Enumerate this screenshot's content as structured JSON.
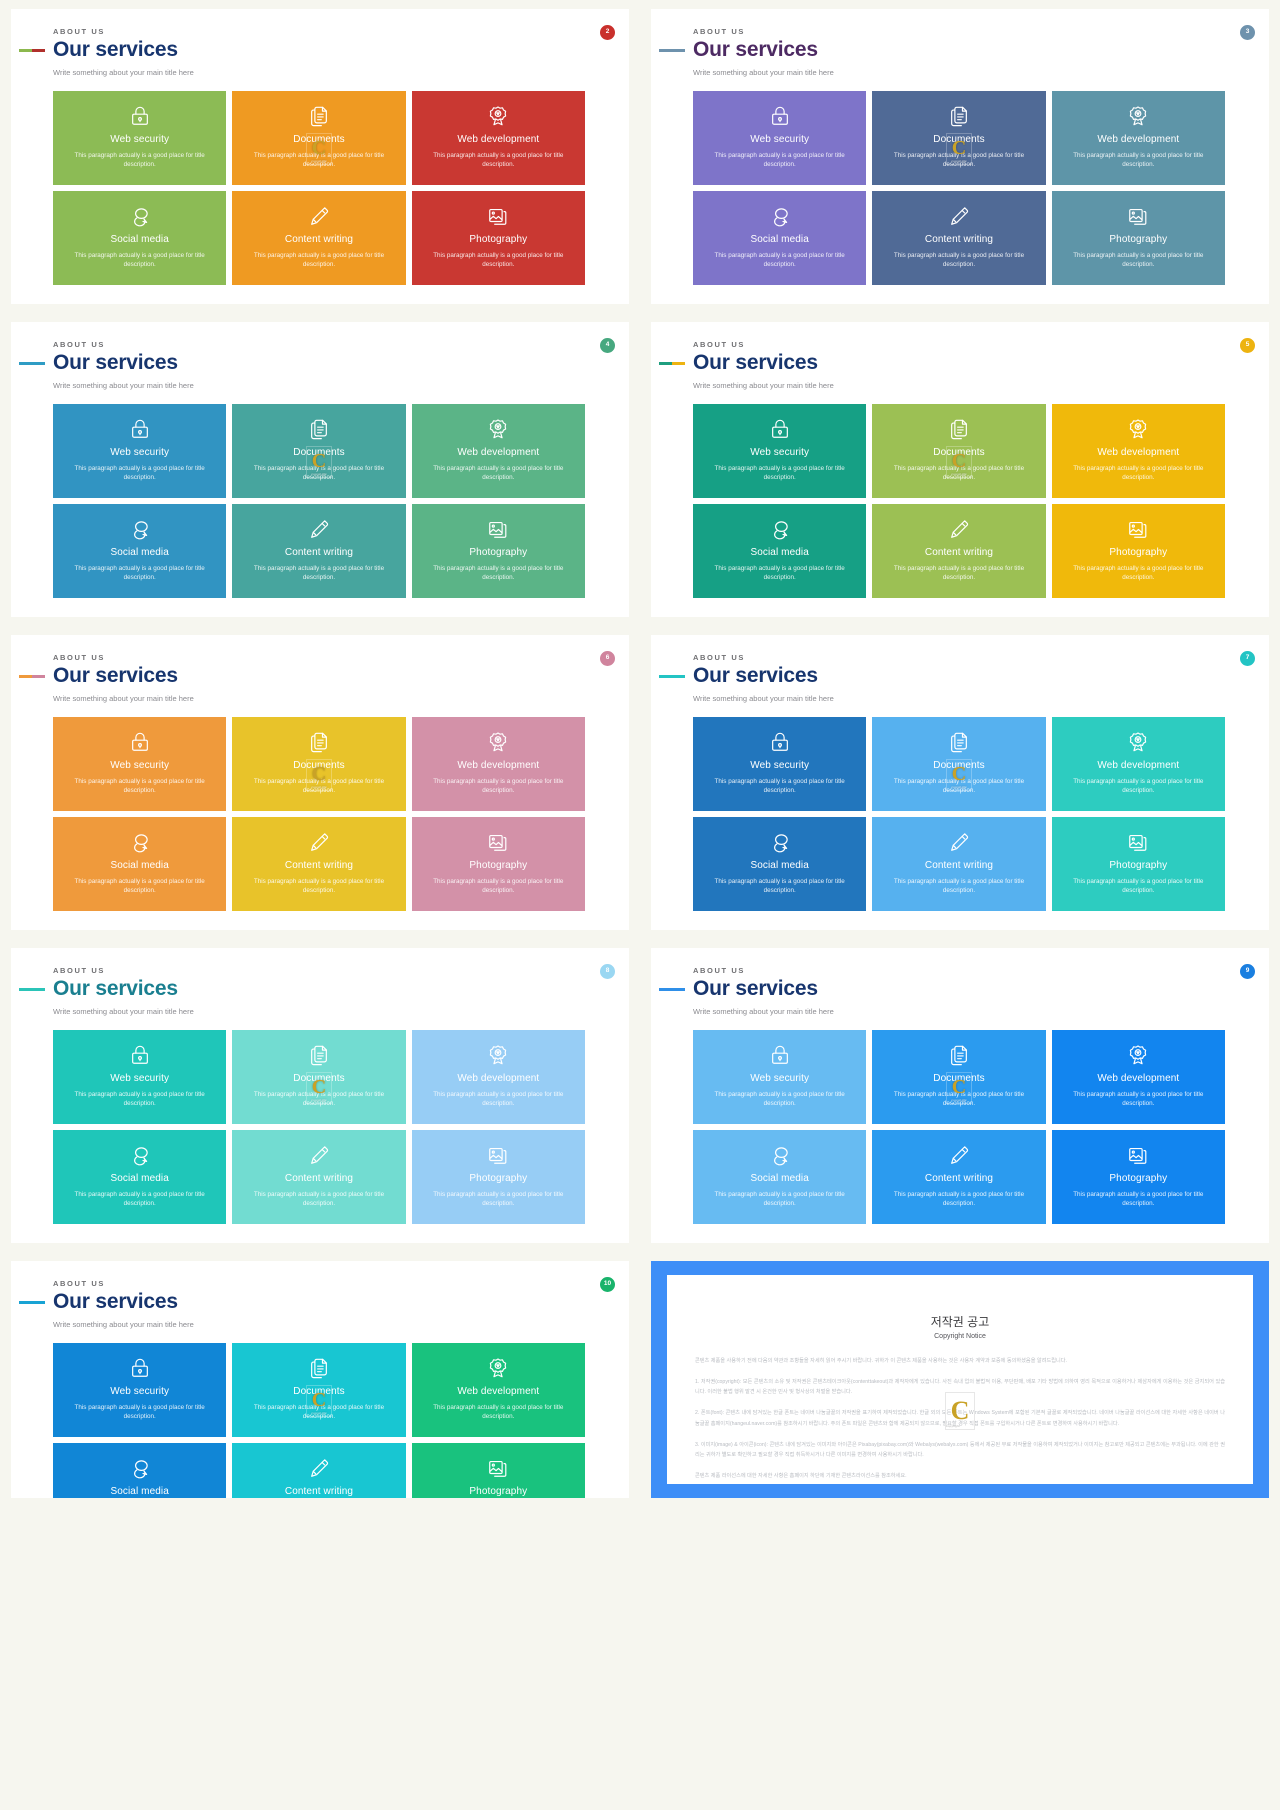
{
  "slide_common": {
    "eyebrow": "ABOUT US",
    "title": "Our services",
    "subtitle": "Write something about your main title here",
    "cards": [
      {
        "icon": "lock-icon",
        "title": "Web security",
        "desc": "This paragraph  actually is a good place for title description."
      },
      {
        "icon": "document-icon",
        "title": "Documents",
        "desc": "This paragraph  actually is a good place for title description."
      },
      {
        "icon": "badge-icon",
        "title": "Web development",
        "desc": "This paragraph  actually is a good place for title description."
      },
      {
        "icon": "chat-icon",
        "title": "Social media",
        "desc": "This paragraph  actually is a good place for title description."
      },
      {
        "icon": "pencil-icon",
        "title": "Content writing",
        "desc": "This paragraph  actually is a good place for title description."
      },
      {
        "icon": "photo-icon",
        "title": "Photography",
        "desc": "This paragraph  actually is a good place for title description."
      }
    ]
  },
  "slides": [
    {
      "id": "slide-green-orange-red",
      "badge": "2",
      "badge_color": "#c9302c",
      "title_color": "#17356e",
      "accent": [
        "#8cb84e",
        "#b0302c"
      ],
      "card_colors": [
        "#8cbb55",
        "#ef9a22",
        "#c93832",
        "#8cbb55",
        "#ef9a22",
        "#c93832"
      ]
    },
    {
      "id": "slide-purple-slate-teal",
      "badge": "3",
      "badge_color": "#6e92ad",
      "title_color": "#4d2a63",
      "accent": [
        "#6e92ad",
        "#6e92ad"
      ],
      "card_colors": [
        "#7e74c9",
        "#506a96",
        "#5e95a8",
        "#7e74c9",
        "#506a96",
        "#5e95a8"
      ]
    },
    {
      "id": "slide-blue-teal-green",
      "badge": "4",
      "badge_color": "#47a87f",
      "title_color": "#17356e",
      "accent": [
        "#2f9cc4",
        "#2f9cc4"
      ],
      "card_colors": [
        "#3194c2",
        "#47a59e",
        "#5bb487",
        "#3194c2",
        "#47a59e",
        "#5bb487"
      ]
    },
    {
      "id": "slide-emerald-olive-gold",
      "badge": "5",
      "badge_color": "#edb310",
      "title_color": "#17356e",
      "accent": [
        "#1f9e7f",
        "#edb310"
      ],
      "card_colors": [
        "#16a085",
        "#9cc054",
        "#f0b90b",
        "#16a085",
        "#9cc054",
        "#f0b90b"
      ]
    },
    {
      "id": "slide-orange-yellow-pink",
      "badge": "6",
      "badge_color": "#d0849d",
      "title_color": "#17356e",
      "accent": [
        "#ef9a3c",
        "#d0849d"
      ],
      "card_colors": [
        "#ef9a3c",
        "#e8c32a",
        "#d391a8",
        "#ef9a3c",
        "#e8c32a",
        "#d391a8"
      ]
    },
    {
      "id": "slide-navy-sky-turquoise",
      "badge": "7",
      "badge_color": "#23c4c4",
      "title_color": "#17356e",
      "accent": [
        "#23c4c4",
        "#23c4c4"
      ],
      "card_colors": [
        "#2276bd",
        "#56b1ef",
        "#2dccc0",
        "#2276bd",
        "#56b1ef",
        "#2dccc0"
      ]
    },
    {
      "id": "slide-turquoise-mint-lightblue",
      "badge": "8",
      "badge_color": "#9ad7f2",
      "title_color": "#1a7f90",
      "accent": [
        "#2bc4b8",
        "#2bc4b8"
      ],
      "card_colors": [
        "#1fc6b9",
        "#72dcd1",
        "#97cdf5",
        "#1fc6b9",
        "#72dcd1",
        "#97cdf5"
      ]
    },
    {
      "id": "slide-skyblue-azure",
      "badge": "9",
      "badge_color": "#1a7fe0",
      "title_color": "#17356e",
      "accent": [
        "#2f8fe8",
        "#2f8fe8"
      ],
      "card_colors": [
        "#67bbf2",
        "#2b9bef",
        "#1285ef",
        "#67bbf2",
        "#2b9bef",
        "#1285ef"
      ]
    },
    {
      "id": "slide-azure-cyan-green",
      "badge": "10",
      "badge_color": "#19b36b",
      "title_color": "#17356e",
      "accent": [
        "#18a3d4",
        "#18a3d4"
      ],
      "card_colors": [
        "#1186d6",
        "#18c6d2",
        "#19c27e",
        "#1186d6",
        "#18c6d2",
        "#19c27e"
      ]
    }
  ],
  "watermark": {
    "letter": "C",
    "caption": "copyright"
  },
  "copyright": {
    "title": "저작권 공고",
    "subtitle": "Copyright Notice",
    "paragraphs": [
      "콘텐츠 제품을 사용하기 전에 다음의 약관과 조항들을 자세히 읽어 주시기 바랍니다. 귀하가 이 콘텐츠 제품을 사용하는 것은 사용자 계약과 보증에 동의하셨음을 알려드립니다.",
      "1. 저작권(copyright): 모든 콘텐츠의 소유 및 저작권은 콘텐츠테이크아웃(contenttakeout)과 제작자에게 있습니다. 사진 속내 업의 불법적 이용, 무단판매, 배포 기타 방법에 의하여 영리 목적으로 이용하거나 제삼자에게 이용하는 것은 금지되어 있습니다. 이러한 불법 행위 발견 시 온건한 민사 및 형사상의 처벌을 받습니다.",
      "2. 폰트(font): 콘텐츠 내에 담겨있는 한글 폰트는 네이버 나눔글꼴의 저작권을 표기하여 제작되었습니다. 한글 외의 모든 폰트는 Windows System에 포함된 기본적 글꼴로 제작되었습니다. 네이버 나눔글꼴 라이선스에 대한 자세한 사항은 네이버 나눔글꼴 홈페이지(hangeul.naver.com)를 참조하시기 바랍니다. 주의 폰트 파일은 콘텐츠와 함께 제공되지 않으므로, 필요할 경우 직접 폰트를 구입하시거나 다른 폰트로 변경하여 사용하시기 바랍니다.",
      "3. 이미지(image) & 아이콘(icon): 콘텐츠 내에 담겨있는 이미지와 아이콘은 Pixabay(pixabay.com)와 Webalys(webalys.com) 등에서 제공된 무료 저작물을 이용하여 제작되었거나 이미지는 참고로만 제공되고 콘텐츠에는 부과됩니다. 이에 관한 권리는 귀하가 별도로 확인하고 필요할 경우 직접 취득하시거나 다른 이미지를 변경하여 사용하시기 바랍니다.",
      "콘텐츠 제품 라이선스에 대한 자세한 사항은 홈페이지 하단에 기재한 콘텐츠라이선스를 참조하세요."
    ]
  }
}
